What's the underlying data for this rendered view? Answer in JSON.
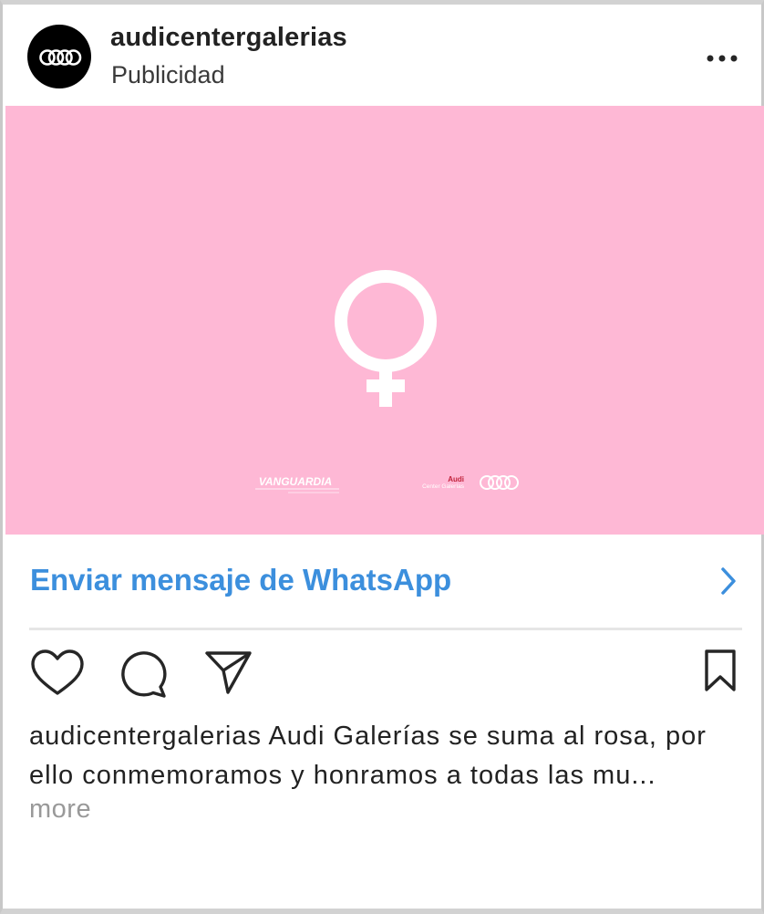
{
  "post": {
    "username": "audicentergalerias",
    "sponsored_label": "Publicidad",
    "menu_icon": "more-dots-icon",
    "avatar_icon": "audi-rings-logo"
  },
  "ad_image": {
    "background_color": "#feb8d5",
    "symbol_icon": "female-symbol-icon",
    "logo_left_text": "VANGUARDIA",
    "logo_right_brand": "Audi",
    "logo_right_text": "Center Galerías"
  },
  "cta": {
    "label": "Enviar mensaje de WhatsApp",
    "color": "#3c8fdd",
    "icon": "chevron-right-icon"
  },
  "actions": {
    "like_icon": "heart-icon",
    "comment_icon": "comment-icon",
    "share_icon": "send-icon",
    "save_icon": "bookmark-icon"
  },
  "caption": {
    "line1": "audicentergalerias Audi Galerías se suma al rosa, por",
    "line2": "ello conmemoramos y honramos a todas las mu...",
    "more_label": "more"
  }
}
